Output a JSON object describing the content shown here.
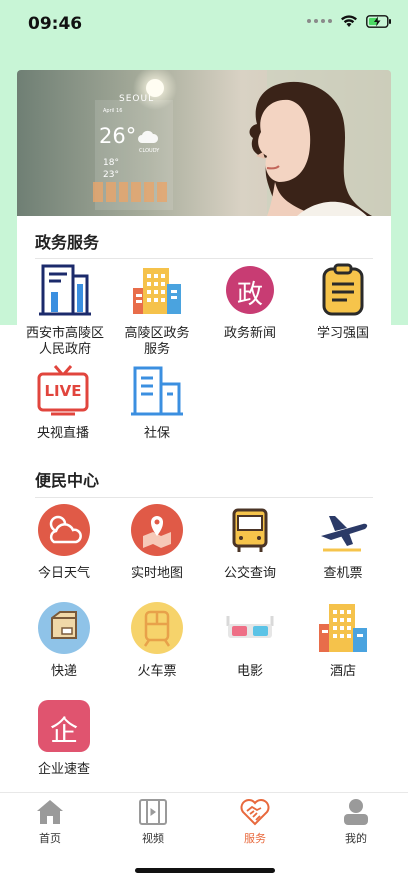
{
  "status": {
    "time": "09:46"
  },
  "banner": {
    "weather_city": "SEOUL",
    "weather_date": "April 16",
    "weather_temp": "26°",
    "weather_cond": "CLOUDY",
    "weather_low": "18°",
    "weather_high": "23°"
  },
  "sections": [
    {
      "title": "政务服务"
    },
    {
      "title": "便民中心"
    }
  ],
  "gov_items": [
    {
      "label": "西安市高陵区\n人民政府",
      "icon": "building-chart-icon"
    },
    {
      "label": "高陵区政务\n服务",
      "icon": "city-buildings-icon"
    },
    {
      "label": "政务新闻",
      "icon": "gov-news-icon",
      "glyph": "政"
    },
    {
      "label": "学习强国",
      "icon": "clipboard-icon"
    },
    {
      "label": "央视直播",
      "icon": "live-tv-icon",
      "glyph": "LIVE"
    },
    {
      "label": "社保",
      "icon": "social-security-building-icon"
    }
  ],
  "convenience_items": [
    {
      "label": "今日天气",
      "icon": "weather-icon"
    },
    {
      "label": "实时地图",
      "icon": "map-icon"
    },
    {
      "label": "公交查询",
      "icon": "bus-icon"
    },
    {
      "label": "查机票",
      "icon": "airplane-icon"
    },
    {
      "label": "快递",
      "icon": "package-icon"
    },
    {
      "label": "火车票",
      "icon": "train-icon"
    },
    {
      "label": "电影",
      "icon": "3d-glasses-icon"
    },
    {
      "label": "酒店",
      "icon": "hotel-icon"
    },
    {
      "label": "企业速查",
      "icon": "enterprise-icon",
      "glyph": "企"
    }
  ],
  "tabs": [
    {
      "label": "首页",
      "icon": "home-icon"
    },
    {
      "label": "视频",
      "icon": "video-icon"
    },
    {
      "label": "服务",
      "icon": "handshake-icon",
      "active": true
    },
    {
      "label": "我的",
      "icon": "user-icon"
    }
  ],
  "colors": {
    "accent": "#e8693d",
    "header_bg": "#c8f5d6"
  }
}
